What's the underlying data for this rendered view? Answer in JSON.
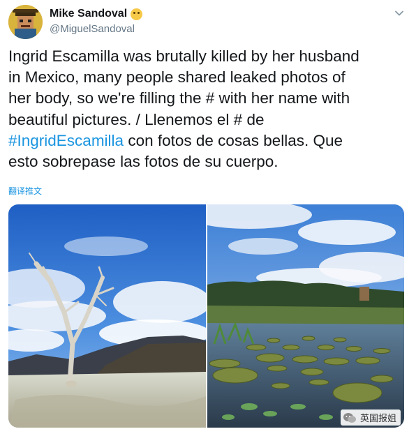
{
  "tweet": {
    "author": {
      "display_name": "Mike Sandoval",
      "name_emoji": "thinking-face-emoji",
      "handle": "@MiguelSandoval",
      "avatar_icon": "pixel-art-avatar-icon"
    },
    "text": {
      "part1": "Ingrid Escamilla was brutally killed by her husband\nin Mexico, many people shared leaked photos of\nher body, so we're filling the # with her name with\nbeautiful pictures. / Llenemos el # de\n",
      "hashtag": "#IngridEscamilla",
      "part2": " con fotos de cosas bellas. Que\nesto sobrepase las fotos de su cuerpo."
    },
    "translate_label": "翻译推文",
    "menu_icon": "chevron-down-icon",
    "media": [
      {
        "icon": "photo-dead-tree-petrified-waterfall"
      },
      {
        "icon": "photo-lily-pad-pond-garden"
      }
    ]
  },
  "watermark": {
    "icon": "wechat-icon",
    "text": "英国报姐"
  },
  "colors": {
    "link": "#1b95e0",
    "text": "#14171a",
    "secondary": "#657786",
    "sky": "#3f7fd0"
  }
}
